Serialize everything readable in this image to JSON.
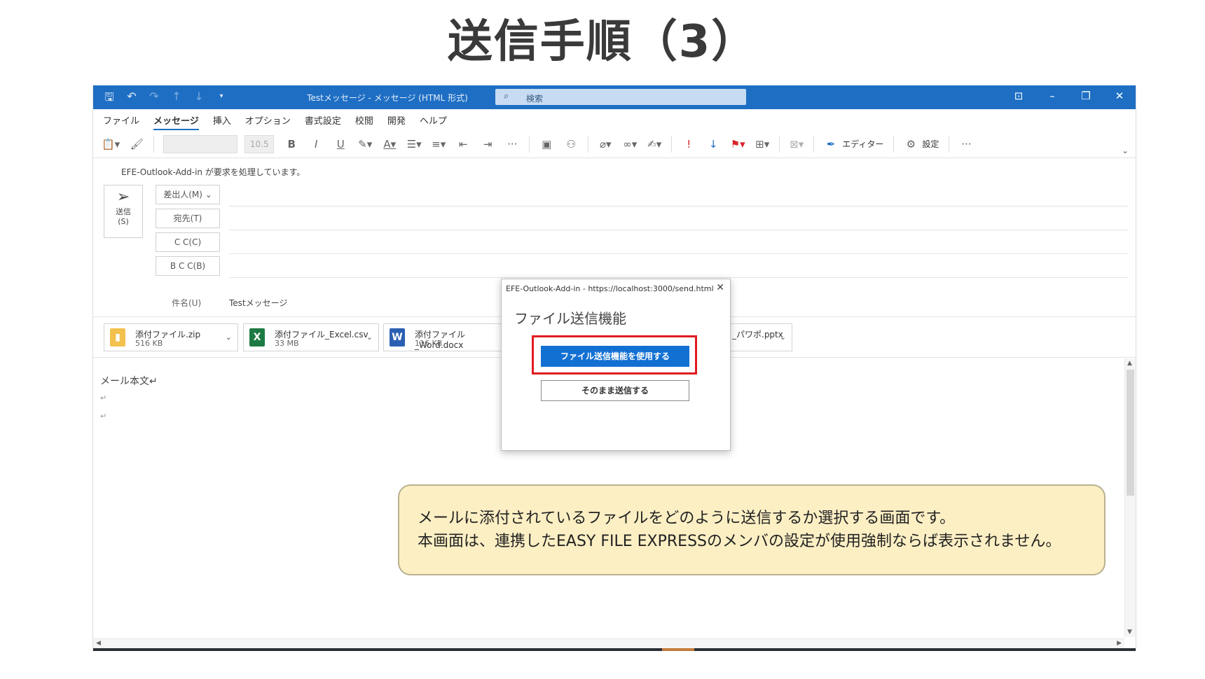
{
  "page": {
    "title": "送信手順（3）"
  },
  "titlebar": {
    "window_title": "Testメッセージ - メッセージ (HTML 形式)",
    "search_placeholder": "検索"
  },
  "menu_tabs": [
    "ファイル",
    "メッセージ",
    "挿入",
    "オプション",
    "書式設定",
    "校閲",
    "開発",
    "ヘルプ"
  ],
  "ribbon": {
    "font_size": "10.5",
    "editor_label": "エディター",
    "settings_label": "設定"
  },
  "compose": {
    "notice": "EFE-Outlook-Add-in が要求を処理しています。",
    "send_label": "送信",
    "send_shortcut": "(S)",
    "from_label": "差出人(M)",
    "to_label": "宛先(T)",
    "cc_label": "C C(C)",
    "bcc_label": "B C C(B)",
    "subject_label": "件名(U)",
    "subject_value": "Testメッセージ"
  },
  "attachments": [
    {
      "name": "添付ファイル.zip",
      "size": "516 KB",
      "icon": "zip-icon",
      "color": "#f2c14e"
    },
    {
      "name": "添付ファイル_Excel.csv",
      "size": "33 MB",
      "icon": "excel-icon",
      "color": "#1d7a43"
    },
    {
      "name": "添付ファイル_Word.docx",
      "size": "116 KB",
      "icon": "word-icon",
      "color": "#2b5fb3"
    },
    {
      "name": "_パワポ.pptx",
      "size": "",
      "icon": "powerpoint-icon",
      "color": "#c9482b"
    }
  ],
  "body": {
    "text": "メール本文↵",
    "return_mark": "↵"
  },
  "dialog": {
    "title": "EFE-Outlook-Add-in - https://localhost:3000/send.html",
    "heading": "ファイル送信機能",
    "primary_button": "ファイル送信機能を使用する",
    "secondary_button": "そのまま送信する"
  },
  "callout": {
    "line1": "メールに添付されているファイルをどのように送信するか選択する画面です。",
    "line2": "本画面は、連携したEASY FILE EXPRESSのメンバの設定が使用強制ならば表示されません。"
  },
  "colors": {
    "titlebar": "#1e6fc4",
    "primary_button": "#1370d3",
    "highlight": "#e11b22",
    "callout_bg": "#fcefc4"
  }
}
